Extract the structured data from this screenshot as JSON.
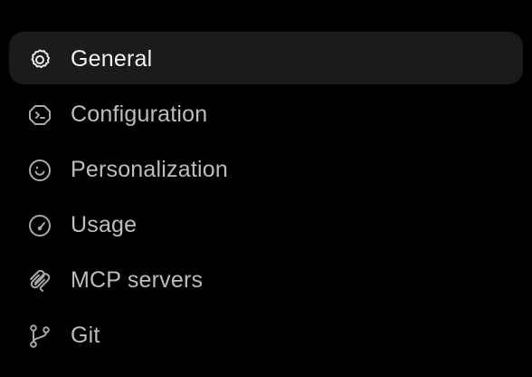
{
  "nav": {
    "items": [
      {
        "label": "General",
        "icon": "gear-icon",
        "active": true
      },
      {
        "label": "Configuration",
        "icon": "terminal-shield-icon",
        "active": false
      },
      {
        "label": "Personalization",
        "icon": "smile-icon",
        "active": false
      },
      {
        "label": "Usage",
        "icon": "gauge-icon",
        "active": false
      },
      {
        "label": "MCP servers",
        "icon": "mcp-icon",
        "active": false
      },
      {
        "label": "Git",
        "icon": "git-branch-icon",
        "active": false
      }
    ]
  },
  "colors": {
    "background": "#000000",
    "active_row": "#1b1b1b",
    "text_active": "#f2f2f2",
    "text_inactive": "#bdbdbd",
    "icon": "#a8a8a8"
  }
}
